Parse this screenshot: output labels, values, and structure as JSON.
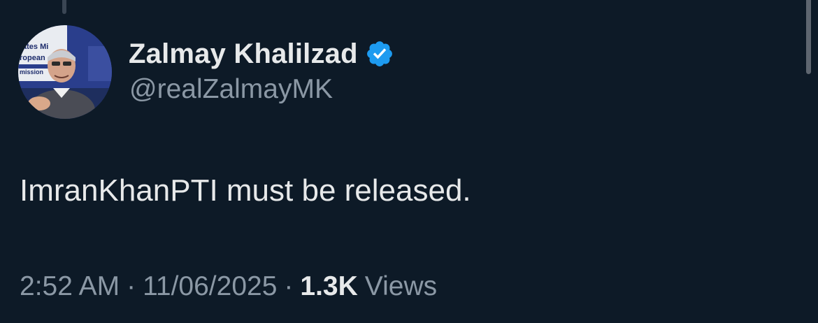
{
  "tweet": {
    "display_name": "Zalmay Khalilzad",
    "handle": "@realZalmayMK",
    "text": "ImranKhanPTI must be released.",
    "time": "2:52 AM",
    "separator": "·",
    "date": "11/06/2025",
    "views_count": "1.3K",
    "views_label": "Views",
    "verified_icon": "verified-badge-icon",
    "avatar_banner_text": [
      "ates Mi",
      "ropean",
      "mission"
    ]
  },
  "colors": {
    "background": "#0d1a27",
    "primary_text": "#e7e9ea",
    "secondary_text": "#8b98a5",
    "verified_blue": "#1d9bf0"
  }
}
